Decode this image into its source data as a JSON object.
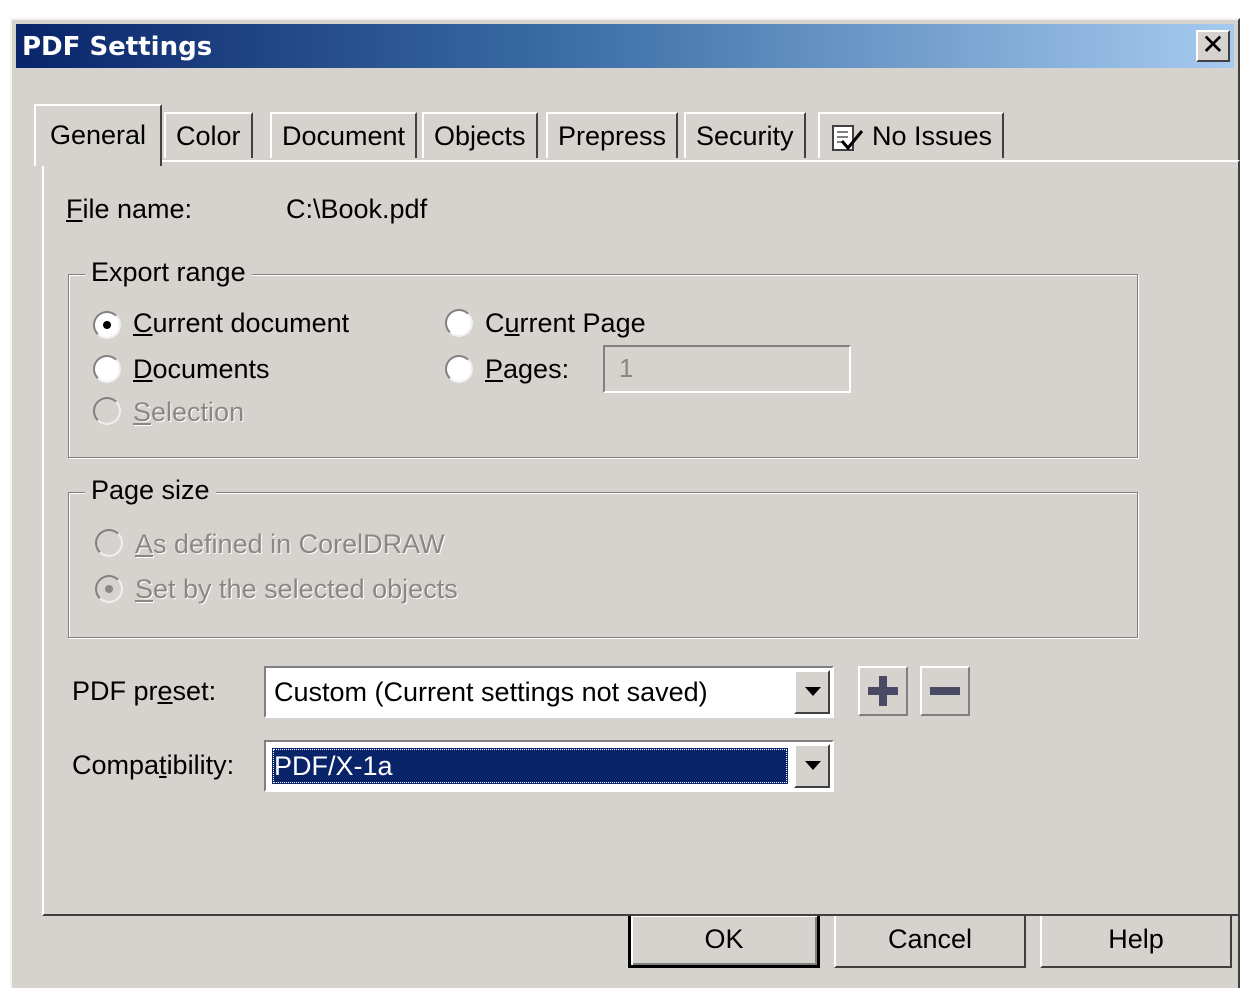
{
  "window": {
    "title": "PDF Settings",
    "close_glyph": "✕"
  },
  "tabs": [
    {
      "label": "General",
      "active": true
    },
    {
      "label": "Color"
    },
    {
      "label": "Document"
    },
    {
      "label": "Objects"
    },
    {
      "label": "Prepress"
    },
    {
      "label": "Security"
    },
    {
      "label": "No Issues",
      "icon": "checklist-icon"
    }
  ],
  "general": {
    "file_name_label_pre": "",
    "file_name_label_mnemonic": "F",
    "file_name_label_post": "ile name:",
    "file_name_value": "C:\\Book.pdf",
    "export_range": {
      "legend": "Export range",
      "current_document": {
        "pre": "",
        "mn": "C",
        "post": "urrent document",
        "selected": true
      },
      "current_page": {
        "pre": "C",
        "mn": "u",
        "post": "rrent Page",
        "selected": false
      },
      "documents": {
        "pre": "",
        "mn": "D",
        "post": "ocuments",
        "selected": false
      },
      "pages": {
        "pre": "",
        "mn": "P",
        "post": "ages:",
        "selected": false,
        "value": "1"
      },
      "selection": {
        "pre": "",
        "mn": "S",
        "post": "election",
        "disabled": true
      }
    },
    "page_size": {
      "legend": "Page size",
      "as_defined": {
        "pre": "",
        "mn": "A",
        "post": "s defined in CorelDRAW",
        "disabled": true
      },
      "set_by_selected": {
        "pre": "",
        "mn": "S",
        "post": "et by the selected objects",
        "disabled": true,
        "selected": true
      }
    },
    "pdf_preset": {
      "label_pre": "PDF pr",
      "label_mn": "e",
      "label_post": "set:",
      "value": "Custom (Current settings not saved)"
    },
    "compatibility": {
      "label_pre": "Compa",
      "label_mn": "t",
      "label_post": "ibility:",
      "value": "PDF/X-1a"
    }
  },
  "buttons": {
    "ok": "OK",
    "cancel": "Cancel",
    "help": "Help"
  },
  "colors": {
    "dialog_bg": "#d6d3ce",
    "title_start": "#0a246a",
    "title_end": "#a6caf0",
    "selection": "#0a246a"
  }
}
